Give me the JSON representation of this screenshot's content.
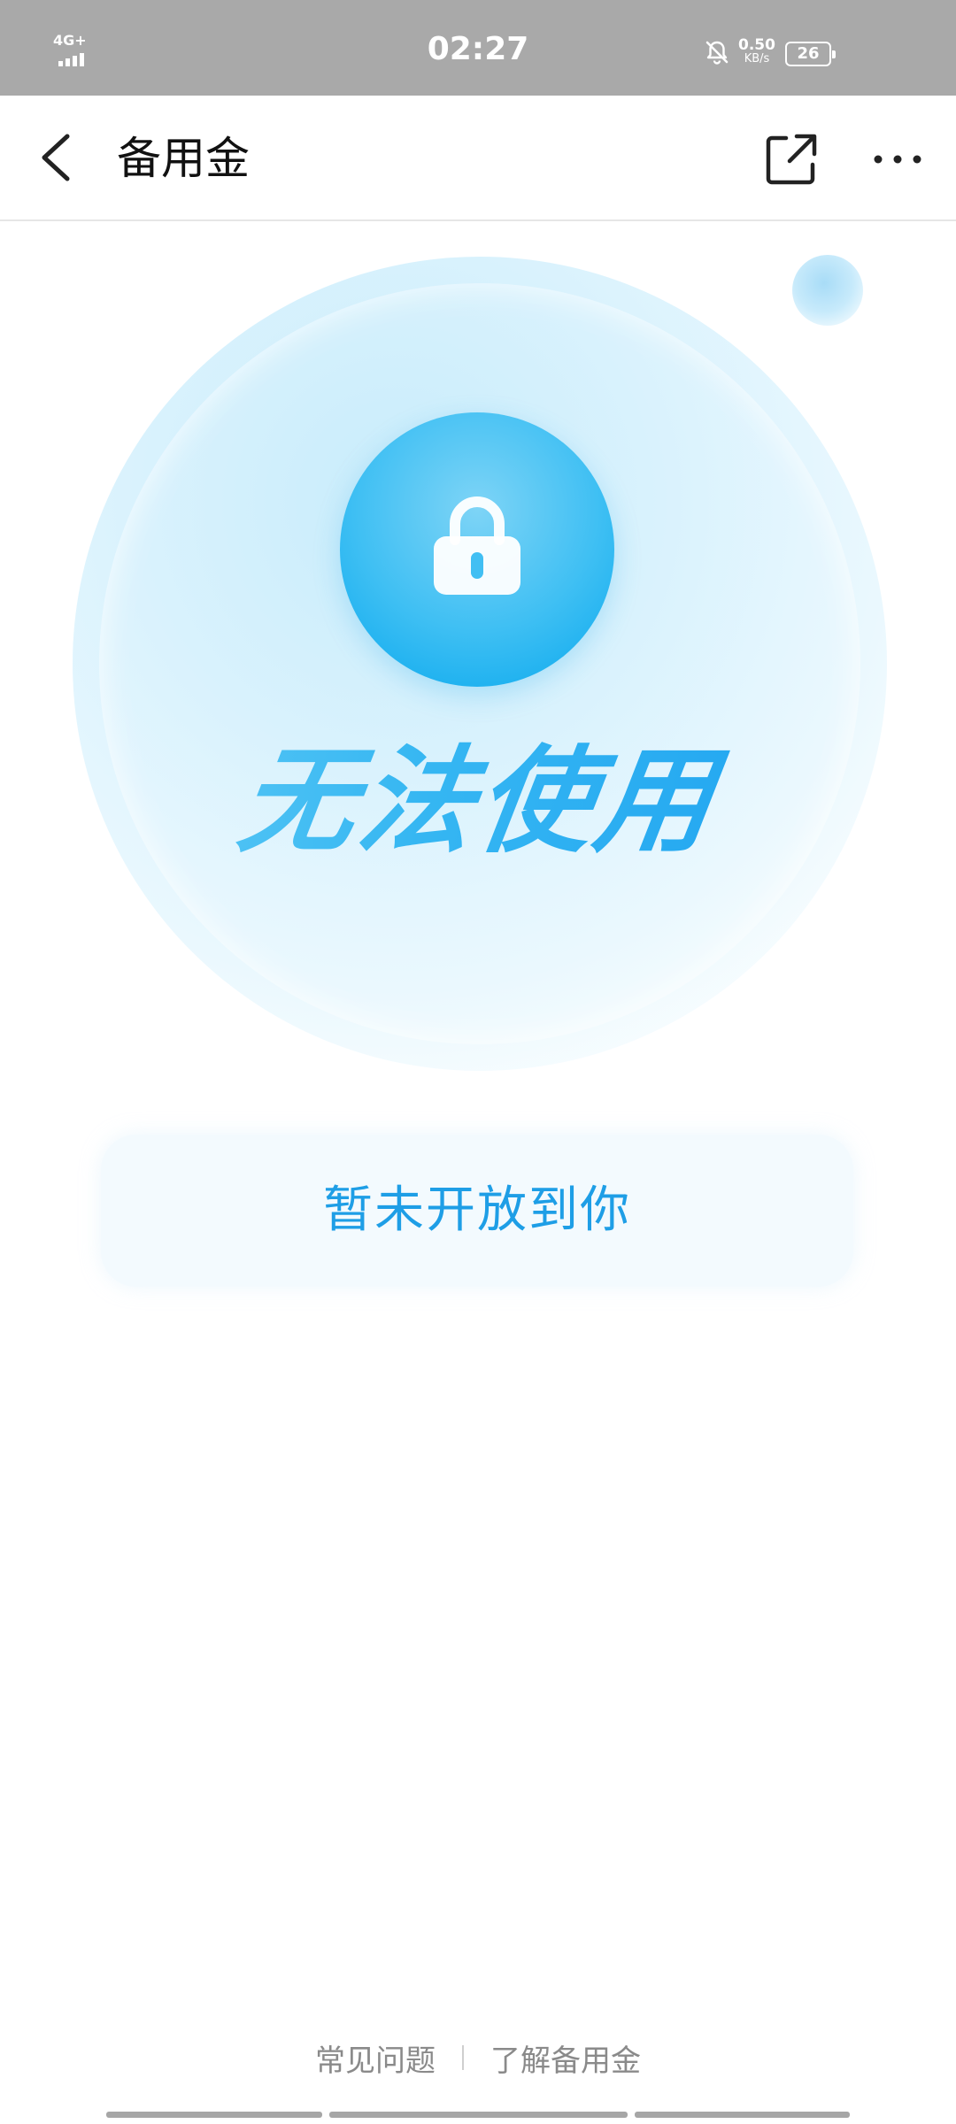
{
  "status_bar": {
    "network": "4G+",
    "time": "02:27",
    "net_speed_value": "0.50",
    "net_speed_unit": "KB/s",
    "battery": "26",
    "icons": [
      "signal-icon",
      "mute-bell-icon",
      "battery-icon"
    ]
  },
  "nav": {
    "title": "备用金",
    "icons": [
      "back-chevron-icon",
      "share-icon",
      "more-icon"
    ]
  },
  "hero": {
    "heading": "无法使用",
    "icon": "lock-icon"
  },
  "notice": {
    "text": "暂未开放到你"
  },
  "footer": {
    "links": [
      "常见问题",
      "了解备用金"
    ]
  },
  "colors": {
    "status_bar_bg": "#a9a9a9",
    "accent_blue": "#1e9ee6",
    "heading_blue": "#25a9ef",
    "card_bg": "#f3fafe",
    "footer_text": "#8a8a8a"
  }
}
